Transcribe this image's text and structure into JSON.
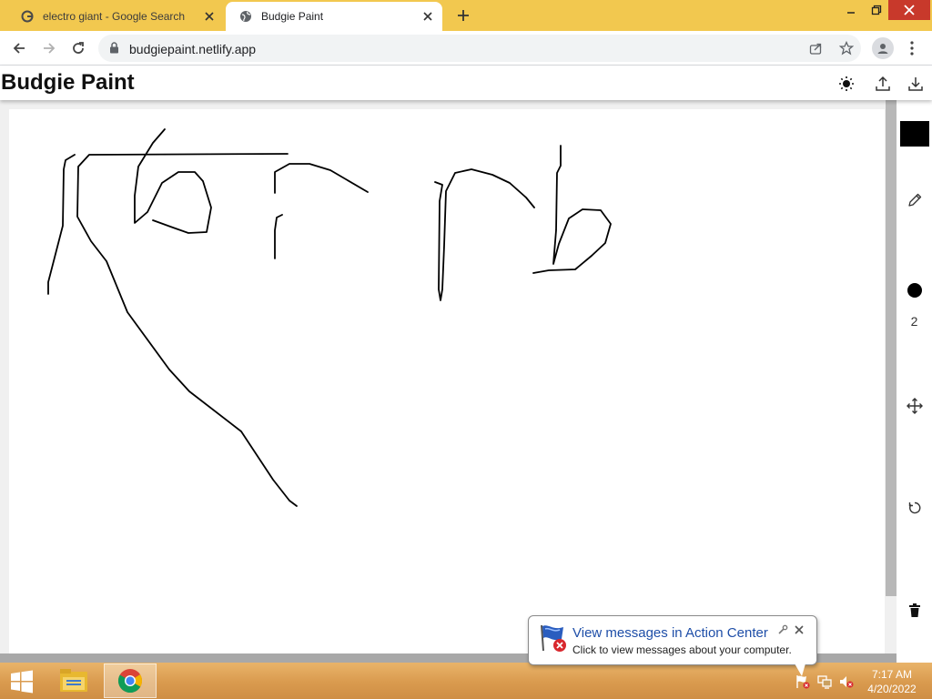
{
  "browser": {
    "tabs": [
      {
        "title": "electro giant - Google Search",
        "icon": "google-icon",
        "active": false
      },
      {
        "title": "Budgie Paint",
        "icon": "globe-icon",
        "active": true
      }
    ],
    "url": "budgiepaint.netlify.app"
  },
  "app": {
    "title": "Budgie Paint",
    "header_icons": [
      "brightness-icon",
      "upload-icon",
      "download-icon"
    ],
    "tools": {
      "color": "#000000",
      "brush_size": "2",
      "items": [
        "color-swatch",
        "pencil-icon",
        "brush-size-dot-icon",
        "move-icon",
        "undo-icon",
        "trash-icon"
      ]
    }
  },
  "notification": {
    "title": "View messages in Action Center",
    "message": "Click to view messages about your computer."
  },
  "taskbar": {
    "time": "7:17 AM",
    "date": "4/20/2022",
    "apps": [
      "file-explorer-icon",
      "chrome-icon"
    ],
    "tray_icons": [
      "action-center-flag-icon",
      "network-icon",
      "volume-muted-icon"
    ]
  },
  "colors": {
    "tabstrip": "#f2c84f",
    "taskbar": "#d99a4e",
    "notification_title": "#1e4ea8",
    "stroke": "#000000"
  }
}
